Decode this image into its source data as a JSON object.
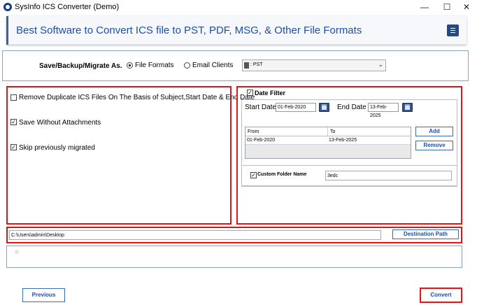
{
  "window": {
    "title": "SysInfo ICS Converter (Demo)",
    "minimize_glyph": "—",
    "maximize_glyph": "☐",
    "close_glyph": "✕"
  },
  "banner": {
    "title": "Best Software to Convert ICS file to PST, PDF, MSG, & Other File Formats",
    "menu_icon": "hamburger-menu-icon"
  },
  "mode": {
    "label": "Save/Backup/Migrate As.",
    "options": [
      {
        "label": "File Formats",
        "selected": true
      },
      {
        "label": "Email Clients",
        "selected": false
      }
    ],
    "format_value": ": PST",
    "format_icon": "pst-file-icon"
  },
  "options_panel": {
    "items": [
      {
        "label": "Remove Duplicate ICS Files On The Basis of Subject,Start Date & End Date",
        "checked": false
      },
      {
        "label": "Save Without Attachments",
        "checked": true
      },
      {
        "label": "Skip previously migrated",
        "checked": true
      }
    ]
  },
  "date_filter": {
    "label": "Date Filter",
    "checked": true,
    "start_label": "Start Date :",
    "start_value": "01-Feb-2020",
    "end_label": "End Date :",
    "end_value": "13-Feb-2025",
    "table": {
      "columns": [
        "From",
        "To"
      ],
      "rows": [
        [
          "01-Feb-2020",
          "13-Feb-2025"
        ]
      ]
    },
    "add_label": "Add",
    "remove_label": "Remove"
  },
  "custom_folder": {
    "label": "Custom Folder Name",
    "checked": true,
    "value": "3edc"
  },
  "destination": {
    "path": "C:\\Users\\admin\\Desktop",
    "button_label": "Destination Path"
  },
  "footer": {
    "previous_label": "Previous",
    "convert_label": "Convert"
  },
  "colors": {
    "highlight": "#e01515",
    "accent": "#1b4fae",
    "button_border": "#3b6ab7"
  }
}
